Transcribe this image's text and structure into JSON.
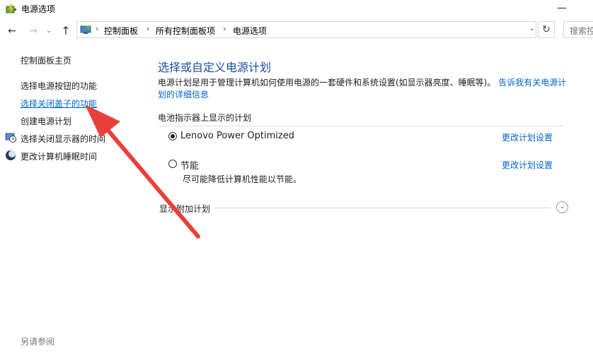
{
  "window": {
    "title": "电源选项"
  },
  "nav": {
    "back_icon": "arrow-left-icon",
    "forward_icon": "arrow-right-icon",
    "recent_icon": "chevron-down-icon",
    "up_icon": "arrow-up-icon",
    "breadcrumbs": [
      "控制面板",
      "所有控制面板项",
      "电源选项"
    ],
    "search_placeholder": "搜索控"
  },
  "sidebar": {
    "items": [
      {
        "label": "控制面板主页"
      },
      {
        "label": "选择电源按钮的功能"
      },
      {
        "label": "选择关闭盖子的功能"
      },
      {
        "label": "创建电源计划"
      },
      {
        "label": "选择关闭显示器的时间",
        "icon": "monitor-clock-icon"
      },
      {
        "label": "更改计算机睡眠时间",
        "icon": "moon-icon"
      }
    ],
    "see_also": "另请参阅"
  },
  "main": {
    "title": "选择或自定义电源计划",
    "description": "电源计划是用于管理计算机如何使用电源的一套硬件和系统设置(如显示器亮度、睡眠等)。",
    "description_link": "告诉我有关电源计划的详细信息",
    "section_heading": "电池指示器上显示的计划",
    "plans": [
      {
        "name": "Lenovo Power Optimized",
        "selected": true,
        "change_link": "更改计划设置"
      },
      {
        "name": "节能",
        "selected": false,
        "change_link": "更改计划设置",
        "description": "尽可能降低计算机性能以节能。"
      }
    ],
    "extra_plans_label": "显示附加计划"
  },
  "annotation": {
    "arrow_color": "#e8413c"
  }
}
